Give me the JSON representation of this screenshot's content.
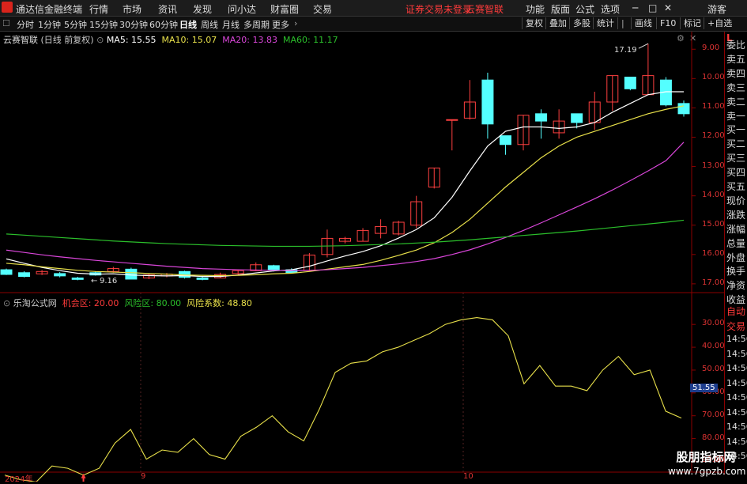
{
  "menubar": {
    "title": "通达信金融终端",
    "items": [
      "行情",
      "市场",
      "资讯",
      "发现",
      "问小达",
      "财富圈",
      "交易"
    ],
    "notice": "证券交易未登录",
    "notice2": "云赛智联",
    "right_items": [
      "功能",
      "版面",
      "公式",
      "选项"
    ],
    "guest": "游客"
  },
  "periodbar": {
    "periods": [
      "分时",
      "1分钟",
      "5分钟",
      "15分钟",
      "30分钟",
      "60分钟",
      "日线",
      "周线",
      "月线",
      "多周期",
      "更多"
    ],
    "active": "日线",
    "tools": [
      "复权",
      "叠加",
      "多股",
      "统计",
      "画线",
      "F10",
      "标记",
      "+自选"
    ]
  },
  "main_chart": {
    "stock_name": "云赛智联",
    "mode": "(日线 前复权)",
    "ma": [
      {
        "label": "MA5: 15.55",
        "color": "#ffffff"
      },
      {
        "label": "MA10: 15.07",
        "color": "#e8e04a"
      },
      {
        "label": "MA20: 13.83",
        "color": "#d946d9"
      },
      {
        "label": "MA60: 11.17",
        "color": "#2bbf2b"
      }
    ],
    "y_ticks": [
      "17.00",
      "16.00",
      "15.00",
      "14.00",
      "13.00",
      "12.00",
      "11.00",
      "10.00",
      "9.00"
    ],
    "high_label": "17.19",
    "low_label": "9.16"
  },
  "indicator": {
    "name": "乐淘公式网",
    "params": [
      {
        "label": "机会区: 20.00",
        "color": "#ff3b3b"
      },
      {
        "label": "风险区: 80.00",
        "color": "#2bbf2b"
      },
      {
        "label": "风险系数: 48.80",
        "color": "#e8e04a"
      }
    ],
    "y_ticks": [
      "90.00",
      "80.00",
      "70.00",
      "60.00",
      "50.00",
      "40.00",
      "30.00"
    ],
    "current": "51.55"
  },
  "x_labels": [
    "2024年",
    "9",
    "10"
  ],
  "right_panel": {
    "top": [
      "L"
    ],
    "items": [
      "委比",
      "卖五",
      "卖四",
      "卖三",
      "卖二",
      "卖一",
      "买一",
      "买二",
      "买三",
      "买四",
      "买五",
      "现价",
      "涨跌",
      "涨幅",
      "总量",
      "外盘",
      "换手",
      "净资",
      "收益"
    ],
    "bottom_items": [
      "自动",
      "交易",
      "14:56",
      "14:56",
      "14:56",
      "14:56",
      "14:56",
      "14:56",
      "14:56",
      "14:56",
      "14:56"
    ]
  },
  "watermark": {
    "line1": "股朋指标网",
    "line2": "www.7gpzb.com"
  },
  "chart_data": [
    {
      "type": "candlestick",
      "title": "云赛智联 (日线 前复权)",
      "ylim": [
        8.7,
        17.6
      ],
      "y_ticks": [
        9,
        10,
        11,
        12,
        13,
        14,
        15,
        16,
        17
      ],
      "candles": [
        {
          "o": 9.48,
          "c": 9.32,
          "h": 9.52,
          "l": 9.3
        },
        {
          "o": 9.38,
          "c": 9.25,
          "h": 9.43,
          "l": 9.22
        },
        {
          "o": 9.34,
          "c": 9.42,
          "h": 9.47,
          "l": 9.3
        },
        {
          "o": 9.35,
          "c": 9.27,
          "h": 9.4,
          "l": 9.22
        },
        {
          "o": 9.2,
          "c": 9.15,
          "h": 9.24,
          "l": 9.12
        },
        {
          "o": 9.38,
          "c": 9.3,
          "h": 9.42,
          "l": 9.28
        },
        {
          "o": 9.42,
          "c": 9.52,
          "h": 9.58,
          "l": 9.38
        },
        {
          "o": 9.5,
          "c": 9.16,
          "h": 9.55,
          "l": 9.16
        },
        {
          "o": 9.2,
          "c": 9.3,
          "h": 9.35,
          "l": 9.16
        },
        {
          "o": 9.27,
          "c": 9.33,
          "h": 9.37,
          "l": 9.22
        },
        {
          "o": 9.42,
          "c": 9.22,
          "h": 9.45,
          "l": 9.18
        },
        {
          "o": 9.2,
          "c": 9.15,
          "h": 9.25,
          "l": 9.12
        },
        {
          "o": 9.2,
          "c": 9.32,
          "h": 9.38,
          "l": 9.2
        },
        {
          "o": 9.35,
          "c": 9.45,
          "h": 9.47,
          "l": 9.3
        },
        {
          "o": 9.45,
          "c": 9.65,
          "h": 9.73,
          "l": 9.43
        },
        {
          "o": 9.62,
          "c": 9.47,
          "h": 9.65,
          "l": 9.42
        },
        {
          "o": 9.48,
          "c": 9.38,
          "h": 9.53,
          "l": 9.35
        },
        {
          "o": 9.45,
          "c": 9.98,
          "h": 10.05,
          "l": 9.43
        },
        {
          "o": 10.0,
          "c": 10.55,
          "h": 10.85,
          "l": 9.9
        },
        {
          "o": 10.45,
          "c": 10.55,
          "h": 10.6,
          "l": 10.38
        },
        {
          "o": 10.45,
          "c": 10.82,
          "h": 10.9,
          "l": 10.45
        },
        {
          "o": 10.72,
          "c": 10.95,
          "h": 11.2,
          "l": 10.55
        },
        {
          "o": 10.7,
          "c": 11.1,
          "h": 11.15,
          "l": 10.65
        },
        {
          "o": 11.0,
          "c": 11.8,
          "h": 12.0,
          "l": 10.9
        },
        {
          "o": 12.3,
          "c": 12.95,
          "h": 12.95,
          "l": 12.25
        },
        {
          "o": 14.6,
          "c": 14.6,
          "h": 14.6,
          "l": 13.55
        },
        {
          "o": 14.65,
          "c": 15.2,
          "h": 15.95,
          "l": 14.6
        },
        {
          "o": 15.95,
          "c": 14.45,
          "h": 16.2,
          "l": 13.95
        },
        {
          "o": 14.05,
          "c": 13.75,
          "h": 14.05,
          "l": 13.4
        },
        {
          "o": 13.75,
          "c": 14.75,
          "h": 14.75,
          "l": 13.55
        },
        {
          "o": 14.8,
          "c": 14.55,
          "h": 14.95,
          "l": 13.95
        },
        {
          "o": 14.15,
          "c": 14.55,
          "h": 14.95,
          "l": 13.95
        },
        {
          "o": 14.8,
          "c": 14.5,
          "h": 14.8,
          "l": 14.3
        },
        {
          "o": 14.5,
          "c": 15.2,
          "h": 15.55,
          "l": 14.25
        },
        {
          "o": 15.2,
          "c": 16.1,
          "h": 16.1,
          "l": 14.9
        },
        {
          "o": 16.05,
          "c": 15.65,
          "h": 16.05,
          "l": 15.6
        },
        {
          "o": 15.45,
          "c": 16.1,
          "h": 17.19,
          "l": 15.45
        },
        {
          "o": 15.95,
          "c": 15.1,
          "h": 16.05,
          "l": 15.05
        },
        {
          "o": 15.15,
          "c": 14.8,
          "h": 15.25,
          "l": 14.7
        }
      ],
      "series": [
        {
          "name": "MA5",
          "values": [
            9.85,
            9.7,
            9.56,
            9.45,
            9.36,
            9.33,
            9.34,
            9.3,
            9.28,
            9.27,
            9.28,
            9.25,
            9.25,
            9.3,
            9.37,
            9.44,
            9.48,
            9.6,
            9.78,
            9.95,
            10.1,
            10.3,
            10.56,
            10.85,
            11.25,
            11.95,
            12.85,
            13.7,
            14.2,
            14.35,
            14.35,
            14.3,
            14.35,
            14.5,
            14.85,
            15.15,
            15.45,
            15.55,
            15.55
          ]
        },
        {
          "name": "MA10",
          "values": [
            9.7,
            9.65,
            9.58,
            9.52,
            9.46,
            9.42,
            9.4,
            9.38,
            9.35,
            9.33,
            9.3,
            9.29,
            9.28,
            9.29,
            9.31,
            9.34,
            9.36,
            9.42,
            9.5,
            9.58,
            9.66,
            9.8,
            9.97,
            10.15,
            10.4,
            10.75,
            11.2,
            11.75,
            12.3,
            12.8,
            13.3,
            13.7,
            14.0,
            14.2,
            14.4,
            14.6,
            14.8,
            14.95,
            15.07
          ]
        },
        {
          "name": "MA20",
          "values": [
            10.15,
            10.07,
            9.99,
            9.92,
            9.86,
            9.8,
            9.75,
            9.7,
            9.65,
            9.6,
            9.56,
            9.52,
            9.5,
            9.48,
            9.47,
            9.46,
            9.45,
            9.46,
            9.48,
            9.52,
            9.56,
            9.62,
            9.68,
            9.76,
            9.86,
            10.0,
            10.16,
            10.36,
            10.58,
            10.82,
            11.08,
            11.35,
            11.62,
            11.9,
            12.2,
            12.52,
            12.85,
            13.2,
            13.83
          ]
        },
        {
          "name": "MA60",
          "values": [
            10.7,
            10.66,
            10.62,
            10.58,
            10.54,
            10.5,
            10.46,
            10.43,
            10.4,
            10.37,
            10.35,
            10.33,
            10.31,
            10.3,
            10.29,
            10.28,
            10.28,
            10.28,
            10.29,
            10.3,
            10.32,
            10.34,
            10.36,
            10.39,
            10.42,
            10.46,
            10.5,
            10.55,
            10.6,
            10.65,
            10.7,
            10.75,
            10.8,
            10.86,
            10.92,
            10.98,
            11.04,
            11.1,
            11.17
          ]
        }
      ]
    },
    {
      "type": "line",
      "title": "乐淘公式网",
      "ylim": [
        26,
        97
      ],
      "y_ticks": [
        30,
        40,
        50,
        60,
        70,
        80,
        90
      ],
      "series": [
        {
          "name": "风险系数",
          "values": [
            24,
            22,
            21,
            28,
            27,
            24,
            27,
            38,
            44,
            31,
            35,
            34,
            40,
            33,
            31,
            41,
            45,
            50,
            43,
            39,
            53,
            69,
            73,
            74,
            78,
            80,
            83,
            86,
            90,
            92,
            93,
            92,
            85,
            64,
            72,
            63,
            63,
            61,
            70,
            76,
            68,
            70,
            52,
            49
          ]
        }
      ],
      "markers": [
        "机会区",
        "机会区"
      ]
    }
  ]
}
